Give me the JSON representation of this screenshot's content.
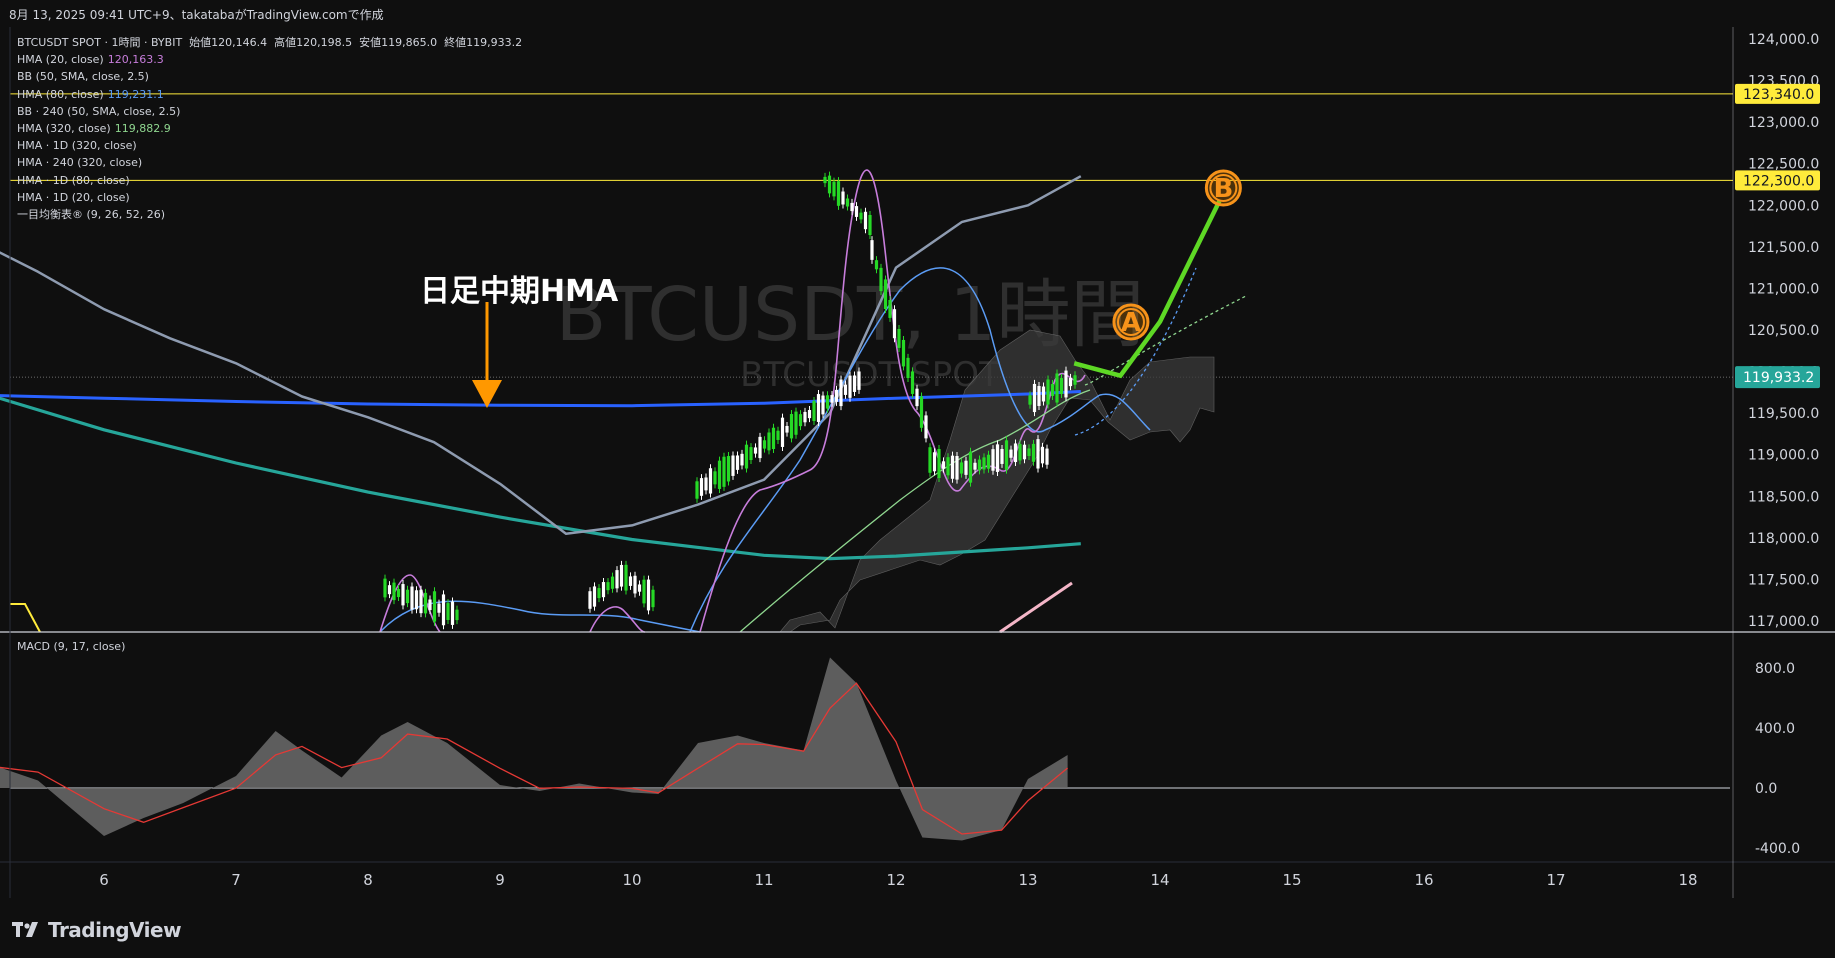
{
  "header": {
    "caption": "8月 13, 2025 09:41 UTC+9、takatabaがTradingView.comで作成"
  },
  "legend": {
    "symbol_line": {
      "symbol": "BTCUSDT SPOT · 1時間 · BYBIT",
      "open_label": "始値",
      "open": "120,146.4",
      "high_label": "高値",
      "high": "120,198.5",
      "low_label": "安値",
      "low": "119,865.0",
      "close_label": "終値",
      "close": "119,933.2"
    },
    "indicators": [
      {
        "label": "HMA (20, close)",
        "value": "120,163.3",
        "color": "#c77ddb"
      },
      {
        "label": "BB (50, SMA, close, 2.5)",
        "value": "",
        "color": ""
      },
      {
        "label": "HMA (80, close)",
        "value": "119,231.1",
        "color": "#5b9cf5"
      },
      {
        "label": "BB · 240 (50, SMA, close, 2.5)",
        "value": "",
        "color": ""
      },
      {
        "label": "HMA (320, close)",
        "value": "119,882.9",
        "color": "#8fd68f"
      },
      {
        "label": "HMA · 1D (320, close)",
        "value": "",
        "color": ""
      },
      {
        "label": "HMA · 240 (320, close)",
        "value": "",
        "color": ""
      },
      {
        "label": "HMA · 1D (80, close)",
        "value": "",
        "color": ""
      },
      {
        "label": "HMA · 1D (20, close)",
        "value": "",
        "color": ""
      },
      {
        "label": "一目均衡表® (9, 26, 52, 26)",
        "value": "",
        "color": ""
      }
    ],
    "macd": "MACD (9, 17, close)"
  },
  "watermark": {
    "title": "BTCUSDT, 1時間",
    "subtitle": "BTCUSDT SPOT"
  },
  "annotation": {
    "text": "日足中期HMA",
    "marker_a": "A",
    "marker_b": "B"
  },
  "brand": {
    "name": "TradingView"
  },
  "colors": {
    "up": "#26d926",
    "down": "#ffffff",
    "hma1d80": "#2962ff",
    "hma1d320": "#26a69a",
    "bb_upper": "#8e9bb0",
    "forecast": "#5ed825",
    "marker": "#f7931a",
    "price_label_bg": "#ffeb3b"
  },
  "chart_data": {
    "type": "line",
    "title": "BTCUSDT, 1時間",
    "x_ticks": [
      "6",
      "7",
      "8",
      "9",
      "10",
      "11",
      "12",
      "13",
      "14",
      "15",
      "16",
      "17",
      "18"
    ],
    "price_axis": {
      "ticks": [
        "124,000.0",
        "123,500.0",
        "123,000.0",
        "122,500.0",
        "122,000.0",
        "121,500.0",
        "121,000.0",
        "120,500.0",
        "120,000.0",
        "119,500.0",
        "119,000.0",
        "118,500.0",
        "118,000.0",
        "117,500.0",
        "117,000.0"
      ],
      "range": [
        116850,
        124100
      ]
    },
    "horizontal_levels": [
      {
        "value": 123340.0,
        "label": "123,340.0",
        "color": "#ffeb3b"
      },
      {
        "value": 122300.0,
        "label": "122,300.0",
        "color": "#ffeb3b"
      }
    ],
    "last_price": {
      "value": 119933.2,
      "label": "119,933.2"
    },
    "macd_axis": {
      "ticks": [
        "800.0",
        "400.0",
        "0.0",
        "-400.0"
      ],
      "range": [
        -500,
        900
      ]
    },
    "series": [
      {
        "name": "HMA · 1D (80, close)",
        "x": [
          5.0,
          6,
          7,
          8,
          9,
          10,
          11,
          12,
          13,
          13.4
        ],
        "y": [
          119720,
          119680,
          119640,
          119610,
          119595,
          119590,
          119620,
          119680,
          119730,
          119760
        ]
      },
      {
        "name": "HMA · 1D (320, close)",
        "x": [
          5.0,
          6,
          7,
          8,
          9,
          10,
          11,
          11.5,
          12,
          13,
          13.4
        ],
        "y": [
          119780,
          119300,
          118900,
          118550,
          118250,
          117980,
          117790,
          117750,
          117780,
          117880,
          117930
        ]
      },
      {
        "name": "BB · 240 (50, SMA, close, 2.5)",
        "x": [
          5.0,
          5.5,
          6,
          6.5,
          7,
          7.5,
          8,
          8.5,
          9,
          9.5,
          10,
          10.5,
          11,
          11.5,
          12,
          12.5,
          13,
          13.4
        ],
        "y": [
          121600,
          121200,
          120750,
          120400,
          120100,
          119700,
          119450,
          119150,
          118650,
          118050,
          118150,
          118400,
          118700,
          119500,
          121250,
          121800,
          122000,
          122350
        ]
      }
    ],
    "forecast_path": {
      "x": [
        13.35,
        13.7,
        14.0,
        14.45
      ],
      "y": [
        120100,
        119950,
        120600,
        122050
      ]
    },
    "macd": {
      "x": [
        5.0,
        5.5,
        6,
        6.3,
        6.6,
        7,
        7.3,
        7.5,
        7.8,
        8.1,
        8.3,
        8.6,
        9,
        9.3,
        9.6,
        10,
        10.2,
        10.5,
        10.8,
        11,
        11.3,
        11.5,
        11.7,
        12,
        12.2,
        12.5,
        12.8,
        13,
        13.3
      ],
      "y": [
        200,
        50,
        -320,
        -200,
        -100,
        80,
        380,
        250,
        70,
        350,
        440,
        300,
        20,
        -20,
        30,
        -30,
        -40,
        300,
        350,
        300,
        250,
        870,
        700,
        50,
        -330,
        -350,
        -280,
        60,
        220
      ]
    }
  }
}
